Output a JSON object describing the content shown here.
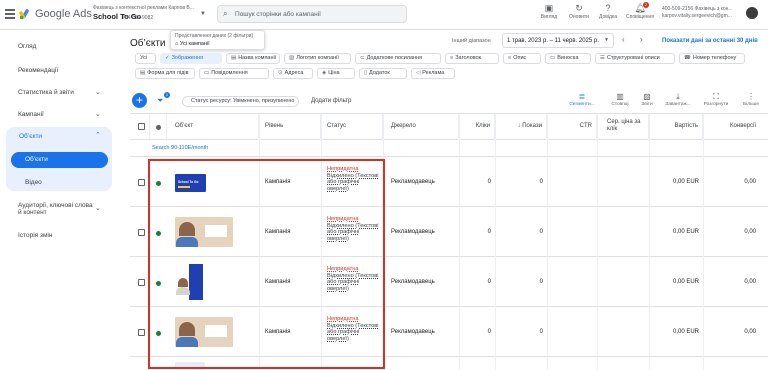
{
  "header": {
    "brand": "Google Ads",
    "account_line1": "Фахівець з контекстної реклами Карпов В...",
    "account_name": "School To Go",
    "account_id": "774-612-9082",
    "search_placeholder": "Пошук сторінки або кампанії",
    "tools": [
      {
        "label": "Вигляд",
        "icon": "view-icon"
      },
      {
        "label": "Оновити",
        "icon": "refresh-icon"
      },
      {
        "label": "Довідка",
        "icon": "help-icon"
      },
      {
        "label": "Сповіщення",
        "icon": "bell-icon",
        "badge": "2"
      }
    ],
    "user_line1": "400-509-2156 Фахівець з кон...",
    "user_line2": "karpov.vitaliy.sergeevich@gm..."
  },
  "sidebar": {
    "items": [
      {
        "label": "Огляд"
      },
      {
        "label": "Рекомендації"
      },
      {
        "label": "Статистика й звіти"
      },
      {
        "label": "Кампанії"
      },
      {
        "label": "Об’єкти"
      },
      {
        "label": "Об'єкти"
      },
      {
        "label": "Відео"
      },
      {
        "label": "Аудиторії, ключові слова й контент"
      },
      {
        "label": "Історія змін"
      }
    ]
  },
  "page": {
    "title": "Об’єкти",
    "filter_popup_line1": "Представлення даних (2 фільтри)",
    "filter_popup_line2": "Усі кампанії",
    "date_label": "Інший діапазон",
    "date_range": "1 трав. 2023 р. – 11 черв. 2025 р.",
    "show_last": "Показати дані за останні 30 днів"
  },
  "chips": {
    "row1": [
      "Усі",
      "Зображення",
      "Назва компанії",
      "Логотип компанії",
      "Додаткове посилання",
      "Заголовок",
      "Опис",
      "Виноска",
      "Структуровані описи",
      "Номер телефону"
    ],
    "row2": [
      "Форма для лідів",
      "Повідомлення",
      "Адреса",
      "Ціна",
      "Додаток",
      "Реклама"
    ]
  },
  "toolbar": {
    "filter_badge": "1",
    "status_chip": "Статус ресурсу: Увімкнено, призупинено",
    "add_filter": "Додати фільтр",
    "buttons": [
      "Сегменти...",
      "Стовпці",
      "Звіти",
      "Завантаж...",
      "Розгорнути",
      "Більше"
    ]
  },
  "table": {
    "headers": {
      "object": "Об’єкт",
      "level": "Рівень",
      "status": "Статус",
      "source": "Джерело",
      "clicks": "Кліки",
      "impressions": "↓ Покази",
      "ctr": "CTR",
      "avg_cpc": "Сер. ціна за клік",
      "cost": "Вартість",
      "conversions": "Конверсії"
    },
    "group_label": "Search 90-110E/month",
    "rows": [
      {
        "level": "Кампанія",
        "status_bad": "Непридатна",
        "status_detail": "Відхилено (Текстові або графічні оверлеї)",
        "source": "Рекламодавець",
        "clicks": "0",
        "impressions": "0",
        "cost": "0,00 EUR",
        "conversions": "0,00",
        "thumb": "blue-wide",
        "thumb_text": "School To Go"
      },
      {
        "level": "Кампанія",
        "status_bad": "Непридатна",
        "status_detail": "Відхилено (Текстові або графічні оверлеї)",
        "source": "Рекламодавець",
        "clicks": "0",
        "impressions": "0",
        "cost": "0,00 EUR",
        "conversions": "0,00",
        "thumb": "beige-wide",
        "thumb_text": ""
      },
      {
        "level": "Кампанія",
        "status_bad": "Непридатна",
        "status_detail": "Відхилено (Текстові або графічні оверлеї)",
        "source": "Рекламодавець",
        "clicks": "0",
        "impressions": "0",
        "cost": "0,00 EUR",
        "conversions": "0,00",
        "thumb": "blue-portrait",
        "thumb_text": ""
      },
      {
        "level": "Кампанія",
        "status_bad": "Непридатна",
        "status_detail": "Відхилено (Текстові або графічні оверлеї)",
        "source": "Рекламодавець",
        "clicks": "0",
        "impressions": "0",
        "cost": "0,00 EUR",
        "conversions": "0,00",
        "thumb": "beige-wide",
        "thumb_text": ""
      }
    ]
  },
  "colors": {
    "accent": "#1a73e8",
    "error": "#d93025",
    "enabled_dot": "#188038"
  }
}
